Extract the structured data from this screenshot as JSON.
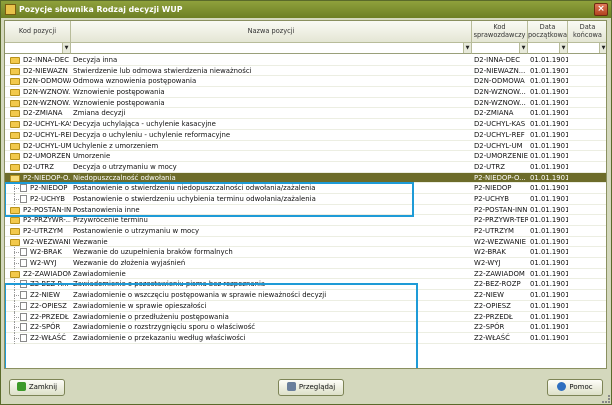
{
  "window": {
    "title": "Pozycje słownika Rodzaj decyzji WUP",
    "close_glyph": "×"
  },
  "columns": [
    "Kod pozycji",
    "Nazwa pozycji",
    "Kod sprawozdawczy",
    "Data początkowa",
    "Data końcowa"
  ],
  "filter_arrow": "▼",
  "rows": [
    {
      "code": "D2-INNA-DEC",
      "name": "Decyzja inna",
      "kod": "D2-INNA-DEC",
      "date": "01.01.1901",
      "type": "folder",
      "level": 0
    },
    {
      "code": "D2-NIEWAZN",
      "name": "Stwierdzenie lub odmowa stwierdzenia nieważności",
      "kod": "D2-NIEWAZN...",
      "date": "01.01.1901",
      "type": "folder",
      "level": 0
    },
    {
      "code": "D2N-ODMOWA",
      "name": "Odmowa wznowienia postępowania",
      "kod": "D2N-ODMOWA",
      "date": "01.01.1901",
      "type": "folder",
      "level": 0
    },
    {
      "code": "D2N-WZNOW...",
      "name": "Wznowienie postępowania",
      "kod": "D2N-WZNOW...",
      "date": "01.01.1901",
      "type": "folder",
      "level": 0
    },
    {
      "code": "D2N-WZNOW...",
      "name": "Wznowienie postępowania",
      "kod": "D2N-WZNOW...",
      "date": "01.01.1901",
      "type": "folder",
      "level": 0
    },
    {
      "code": "D2-ZMIANA",
      "name": "Zmiana decyzji",
      "kod": "D2-ZMIANA",
      "date": "01.01.1901",
      "type": "folder",
      "level": 0
    },
    {
      "code": "D2-UCHYL-KAS",
      "name": "Decyzja uchylająca - uchylenie kasacyjne",
      "kod": "D2-UCHYL-KAS",
      "date": "01.01.1901",
      "type": "folder",
      "level": 0
    },
    {
      "code": "D2-UCHYL-REF",
      "name": "Decyzja o uchyleniu - uchylenie reformacyjne",
      "kod": "D2-UCHYL-REF",
      "date": "01.01.1901",
      "type": "folder",
      "level": 0
    },
    {
      "code": "D2-UCHYL-UM",
      "name": "Uchylenie z umorzeniem",
      "kod": "D2-UCHYL-UM",
      "date": "01.01.1901",
      "type": "folder",
      "level": 0
    },
    {
      "code": "D2-UMORZENIE",
      "name": "Umorzenie",
      "kod": "D2-UMORZENIE",
      "date": "01.01.1901",
      "type": "folder",
      "level": 0
    },
    {
      "code": "D2-UTRZ",
      "name": "Decyzja o utrzymaniu w mocy",
      "kod": "D2-UTRZ",
      "date": "01.01.1901",
      "type": "folder",
      "level": 0
    },
    {
      "code": "P2-NIEDOP-O...",
      "name": "Niedopuszczalność odwołania",
      "kod": "P2-NIEDOP-O...",
      "date": "01.01.1901",
      "type": "folder-open",
      "level": 0,
      "selected": true
    },
    {
      "code": "P2-NIEDOP",
      "name": "Postanowienie o stwierdzeniu niedopuszczalności odwołania/zażalenia",
      "kod": "P2-NIEDOP",
      "date": "01.01.1901",
      "type": "doc",
      "level": 1
    },
    {
      "code": "P2-UCHYB",
      "name": "Postanowienie o stwierdzeniu uchybienia terminu odwołania/zażalenia",
      "kod": "P2-UCHYB",
      "date": "01.01.1901",
      "type": "doc",
      "level": 1
    },
    {
      "code": "P2-POSTAN-INN",
      "name": "Postanowienia inne",
      "kod": "P2-POSTAN-INN",
      "date": "01.01.1901",
      "type": "folder",
      "level": 0
    },
    {
      "code": "P2-PRZYWR-...",
      "name": "Przywrócenie terminu",
      "kod": "P2-PRZYWR-TER",
      "date": "01.01.1901",
      "type": "folder",
      "level": 0
    },
    {
      "code": "P2-UTRZYM",
      "name": "Postanowienie o utrzymaniu w mocy",
      "kod": "P2-UTRZYM",
      "date": "01.01.1901",
      "type": "folder",
      "level": 0
    },
    {
      "code": "W2-WEZWANIE",
      "name": "Wezwanie",
      "kod": "W2-WEZWANIE",
      "date": "01.01.1901",
      "type": "folder-open",
      "level": 0
    },
    {
      "code": "W2-BRAK",
      "name": "Wezwanie do uzupełnienia braków formalnych",
      "kod": "W2-BRAK",
      "date": "01.01.1901",
      "type": "doc",
      "level": 1
    },
    {
      "code": "W2-WYJ",
      "name": "Wezwanie do złożenia wyjaśnień",
      "kod": "W2-WYJ",
      "date": "01.01.1901",
      "type": "doc",
      "level": 1
    },
    {
      "code": "Z2-ZAWIADOM",
      "name": "Zawiadomienie",
      "kod": "Z2-ZAWIADOM",
      "date": "01.01.1901",
      "type": "folder-open",
      "level": 0
    },
    {
      "code": "Z2-BEZ-R...",
      "name": "Zawiadomienie o pozostawieniu pisma bez rozpoznania",
      "kod": "Z2-BEZ-ROZP",
      "date": "01.01.1901",
      "type": "doc",
      "level": 1
    },
    {
      "code": "Z2-NIEW",
      "name": "Zawiadomienie o wszczęciu postępowania w sprawie nieważności decyzji",
      "kod": "Z2-NIEW",
      "date": "01.01.1901",
      "type": "doc",
      "level": 1
    },
    {
      "code": "Z2-OPIESZ",
      "name": "Zawiadomienie w sprawie opieszałości",
      "kod": "Z2-OPIESZ",
      "date": "01.01.1901",
      "type": "doc",
      "level": 1
    },
    {
      "code": "Z2-PRZEDŁ",
      "name": "Zawiadomienie o przedłużeniu postępowania",
      "kod": "Z2-PRZEDŁ",
      "date": "01.01.1901",
      "type": "doc",
      "level": 1
    },
    {
      "code": "Z2-SPÓR",
      "name": "Zawiadomienie o rozstrzygnięciu sporu o właściwość",
      "kod": "Z2-SPÓR",
      "date": "01.01.1901",
      "type": "doc",
      "level": 1
    },
    {
      "code": "Z2-WŁAŚĆ",
      "name": "Zawiadomienie o przekazaniu według właściwości",
      "kod": "Z2-WŁAŚĆ",
      "date": "01.01.1901",
      "type": "doc",
      "level": 1
    }
  ],
  "buttons": {
    "close": "Zamknij",
    "browse": "Przeglądaj",
    "help": "Pomoc"
  },
  "colors": {
    "selected_row": "#6d6c2a",
    "highlight_box": "#1e9bd7",
    "title_bar": "#7d8f30"
  }
}
